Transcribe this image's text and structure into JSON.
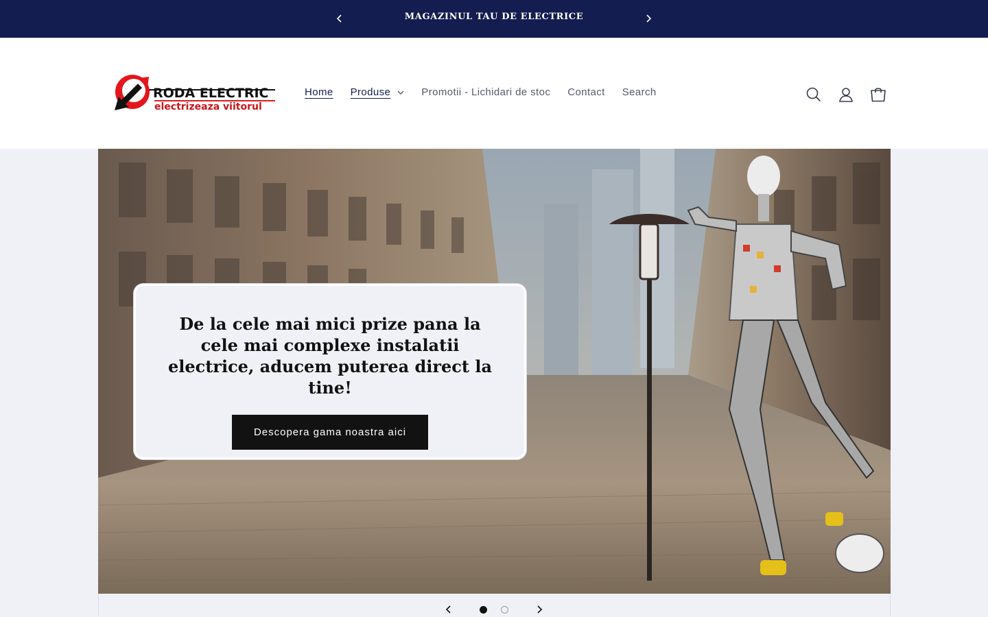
{
  "announcement": {
    "text": "MAGAZINUL TAU DE ELECTRICE"
  },
  "logo": {
    "brand": "RODA ELECTRIC",
    "tagline": "electrizeaza viitorul"
  },
  "nav": {
    "items": [
      {
        "label": "Home"
      },
      {
        "label": "Produse"
      },
      {
        "label": "Promotii - Lichidari de stoc"
      },
      {
        "label": "Contact"
      },
      {
        "label": "Search"
      }
    ]
  },
  "header_icons": [
    "search-icon",
    "account-icon",
    "cart-icon"
  ],
  "hero": {
    "heading": "De la cele mai mici prize pana la cele mai complexe instalatii electrice, aducem puterea direct la tine!",
    "button_label": "Descopera gama noastra aici",
    "slide_count": 2,
    "active_slide": 1
  },
  "colors": {
    "announcement_bg": "#131d4f",
    "button_bg": "#121212",
    "logo_red": "#e3161c",
    "page_bg": "#f0f1f6"
  }
}
